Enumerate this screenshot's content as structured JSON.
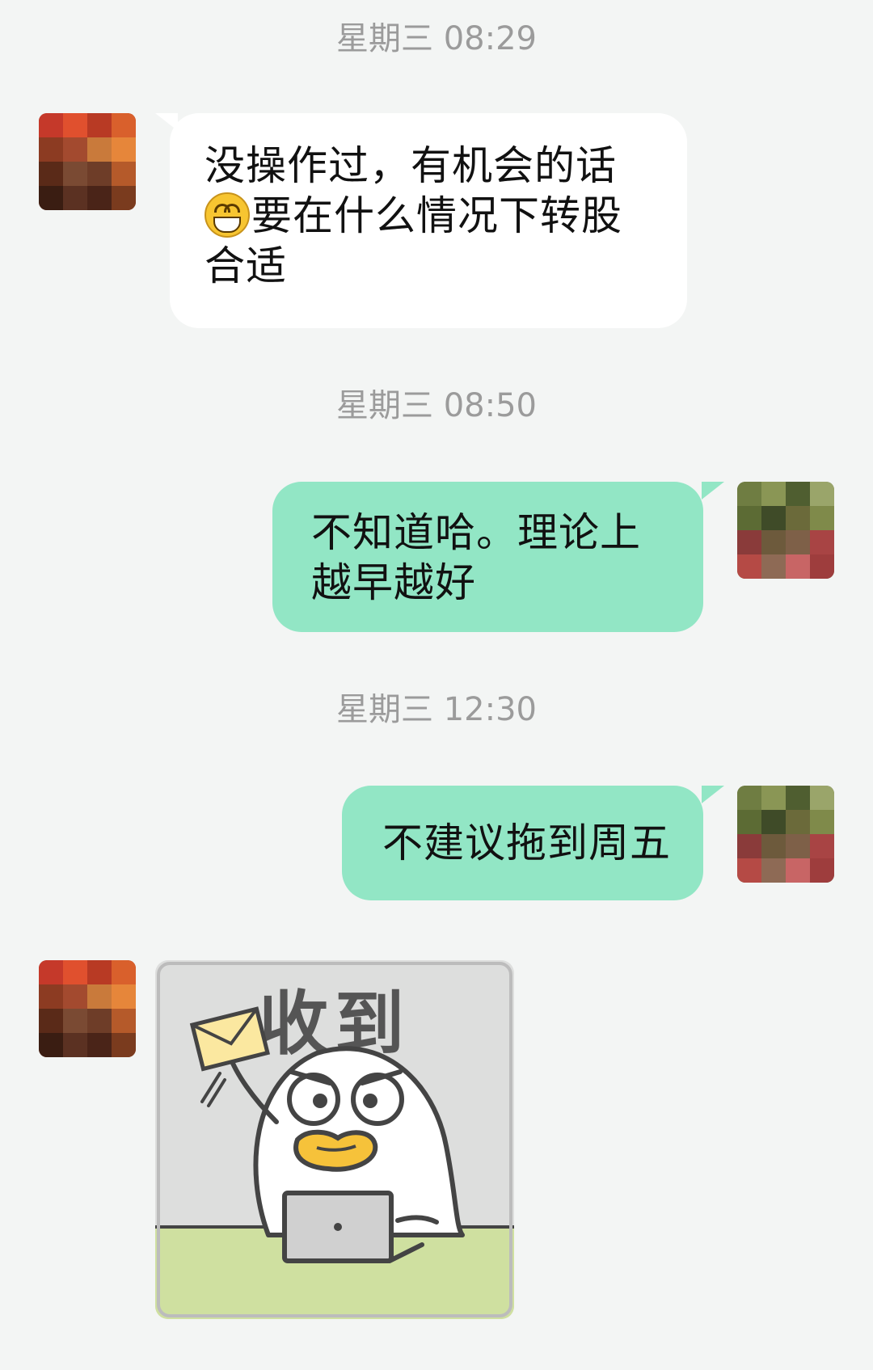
{
  "messages": [
    {
      "type": "timestamp",
      "text": "星期三 08:29"
    },
    {
      "type": "incoming",
      "lines": [
        "没操作过，有机会的话",
        "要在什么情况下转股",
        "合适"
      ],
      "emoji": "grinning-face-emoji"
    },
    {
      "type": "timestamp",
      "text": "星期三 08:50"
    },
    {
      "type": "outgoing",
      "lines": [
        "不知道哈。理论上",
        "越早越好"
      ]
    },
    {
      "type": "timestamp",
      "text": "星期三 12:30"
    },
    {
      "type": "outgoing",
      "lines": [
        "不建议拖到周五"
      ]
    },
    {
      "type": "incoming-sticker",
      "caption": "收到",
      "icon": "duck-sticker-icon"
    }
  ],
  "colors": {
    "background": "#f3f5f4",
    "incoming_bubble": "#ffffff",
    "outgoing_bubble": "#92e6c5",
    "timestamp": "#9b9b9b"
  }
}
